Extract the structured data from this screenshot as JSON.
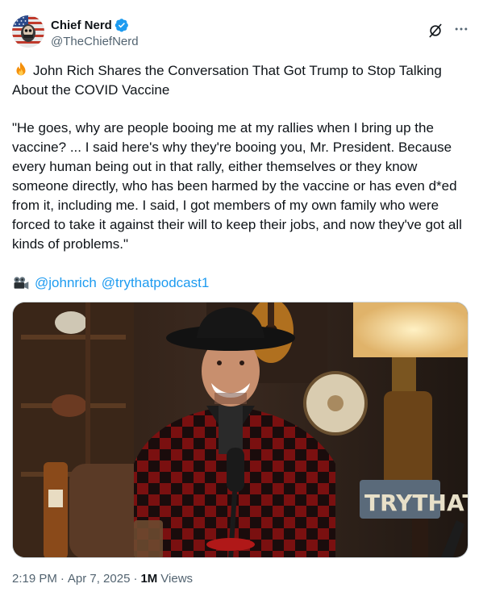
{
  "author": {
    "name": "Chief Nerd",
    "handle": "@TheChiefNerd",
    "verified_color": "#1d9bf0"
  },
  "post": {
    "headline": "John Rich Shares the Conversation That Got Trump to Stop Talking About the COVID Vaccine",
    "quote": "\"He goes, why are people booing me at my rallies when I bring up the vaccine? ... I said here's why they're booing you, Mr. President. Because every human being out in that rally, either themselves or they know someone directly, who has been harmed by the vaccine or has even d*ed from it, including me. I said, I got members of my own family who were forced to take it against their will to keep their jobs, and now they've got all kinds of problems.\"",
    "mentions": [
      "@johnrich",
      "@trythatpodcast1"
    ],
    "media_sign_text": "TRYTHAT"
  },
  "meta": {
    "time": "2:19 PM",
    "separator": "·",
    "date": "Apr 7, 2025",
    "views_count": "1M",
    "views_label": "Views"
  },
  "icons": {
    "header_actions": [
      "grok-icon",
      "more-icon"
    ],
    "headline_emoji": "fire-icon",
    "mentions_emoji": "video-camera-icon"
  },
  "colors": {
    "link": "#1d9bf0",
    "secondary_text": "#536471",
    "primary_text": "#0f1419"
  }
}
